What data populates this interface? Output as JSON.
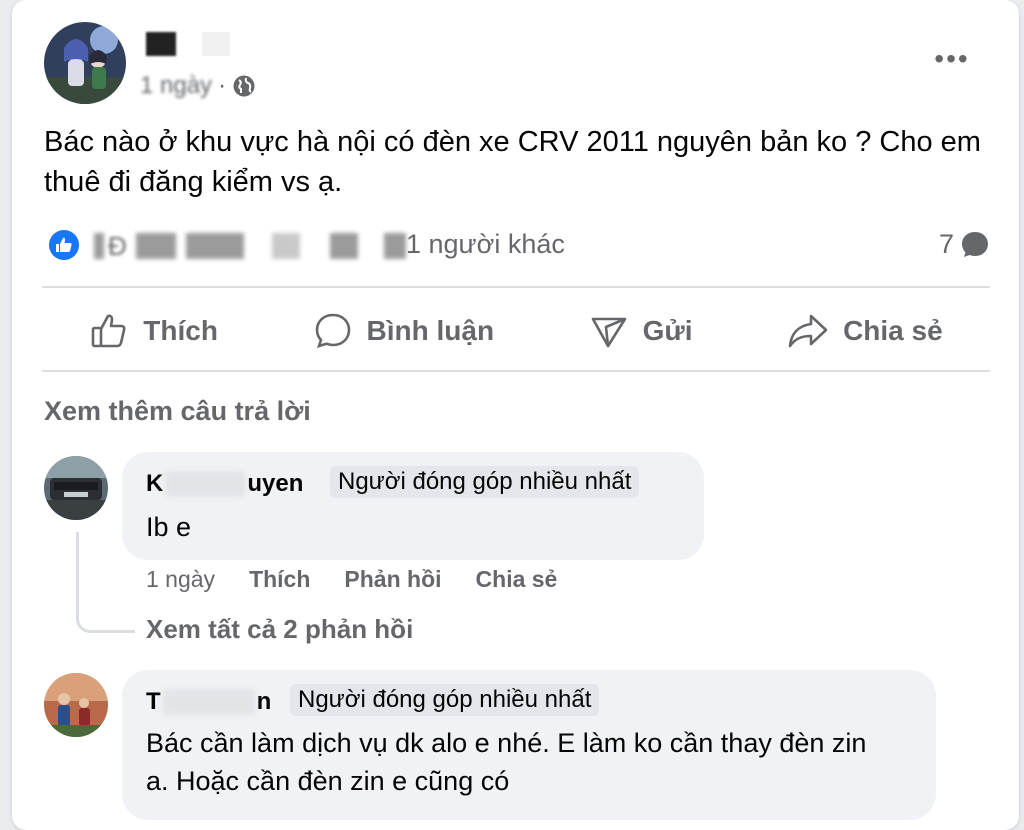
{
  "post": {
    "meta_time": "1 ngày",
    "meta_sep": "·",
    "text": "Bác nào ở khu vực hà nội có đèn xe CRV 2011 nguyên bản ko ? Cho em thuê đi đăng kiểm vs ạ.",
    "reactions_prefix": "Đ",
    "reactions_others": "1 người khác",
    "comment_count": "7",
    "more_label": "•••"
  },
  "actions": [
    {
      "label": "Thích",
      "icon": "like-icon"
    },
    {
      "label": "Bình luận",
      "icon": "comment-icon"
    },
    {
      "label": "Gửi",
      "icon": "send-icon"
    },
    {
      "label": "Chia sẻ",
      "icon": "share-icon"
    }
  ],
  "see_more_replies": "Xem thêm câu trả lời",
  "comments": [
    {
      "name_start": "K",
      "name_end": "uyen",
      "badge": "Người đóng góp nhiều nhất",
      "text": "Ib e",
      "time": "1 ngày",
      "like": "Thích",
      "reply": "Phản hồi",
      "share": "Chia sẻ",
      "view_replies": "Xem tất cả 2 phản hồi"
    },
    {
      "name_start": "T",
      "name_end": "n",
      "badge": "Người đóng góp nhiều nhất",
      "text": "Bác cần làm dịch vụ dk alo e nhé. E làm ko cần thay đèn zin a. Hoặc cần đèn zin e cũng có"
    }
  ],
  "colors": {
    "primary_blue": "#1877f2",
    "secondary_text": "#65676b",
    "bubble_bg": "#f0f2f5"
  }
}
